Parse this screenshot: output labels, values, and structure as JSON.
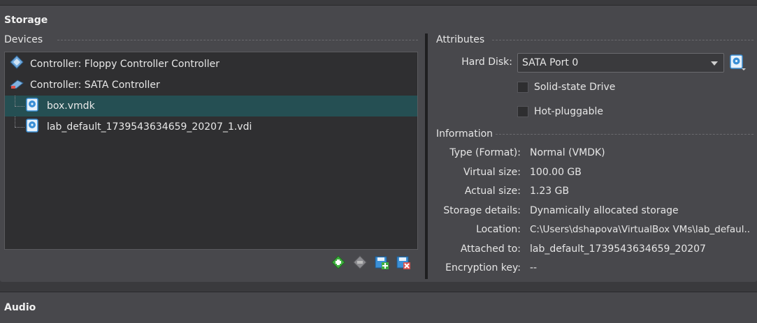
{
  "storage": {
    "title": "Storage",
    "devices": {
      "label": "Devices",
      "items": [
        {
          "text": "Controller: Floppy Controller Controller",
          "icon": "floppy-controller-icon"
        },
        {
          "text": "Controller: SATA Controller",
          "icon": "sata-controller-icon"
        },
        {
          "text": "box.vmdk",
          "icon": "hard-disk-icon",
          "selected": true
        },
        {
          "text": "lab_default_1739543634659_20207_1.vdi",
          "icon": "hard-disk-icon"
        }
      ],
      "buttons": [
        "add-controller-icon",
        "remove-controller-icon",
        "add-attachment-icon",
        "remove-attachment-icon"
      ]
    },
    "attributes": {
      "label": "Attributes",
      "hard_disk_label": "Hard Disk:",
      "hard_disk_value": "SATA Port 0",
      "solid_state_label": "Solid-state Drive",
      "solid_state_checked": false,
      "hot_pluggable_label": "Hot-pluggable",
      "hot_pluggable_checked": false
    },
    "information": {
      "label": "Information",
      "rows": [
        {
          "label": "Type (Format):",
          "value": "Normal (VMDK)"
        },
        {
          "label": "Virtual size:",
          "value": "100.00 GB"
        },
        {
          "label": "Actual size:",
          "value": "1.23 GB"
        },
        {
          "label": "Storage details:",
          "value": "Dynamically allocated storage"
        },
        {
          "label": "Location:",
          "value": "C:\\Users\\dshapova\\VirtualBox VMs\\lab_defaul..."
        },
        {
          "label": "Attached to:",
          "value": "lab_default_1739543634659_20207"
        },
        {
          "label": "Encryption key:",
          "value": "--"
        }
      ]
    }
  },
  "audio": {
    "title": "Audio"
  },
  "colors": {
    "selection": "#254f53",
    "panel": "#48484c",
    "tree_bg": "#2f2f31",
    "accent_blue": "#3a8fd6",
    "accent_green": "#3fae3f"
  }
}
